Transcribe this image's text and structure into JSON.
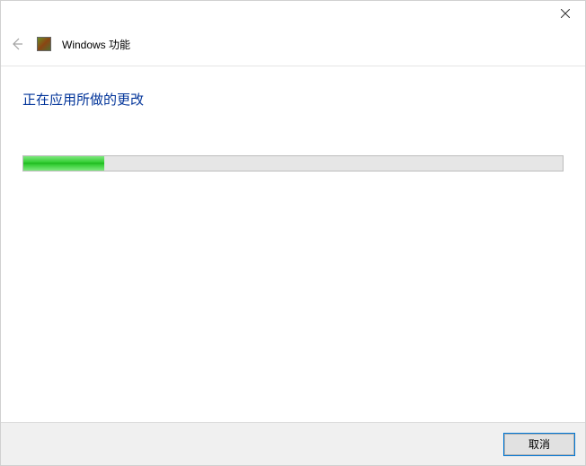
{
  "window": {
    "title": "Windows 功能"
  },
  "content": {
    "heading": "正在应用所做的更改",
    "progress_percent": 15
  },
  "footer": {
    "cancel_label": "取消"
  }
}
